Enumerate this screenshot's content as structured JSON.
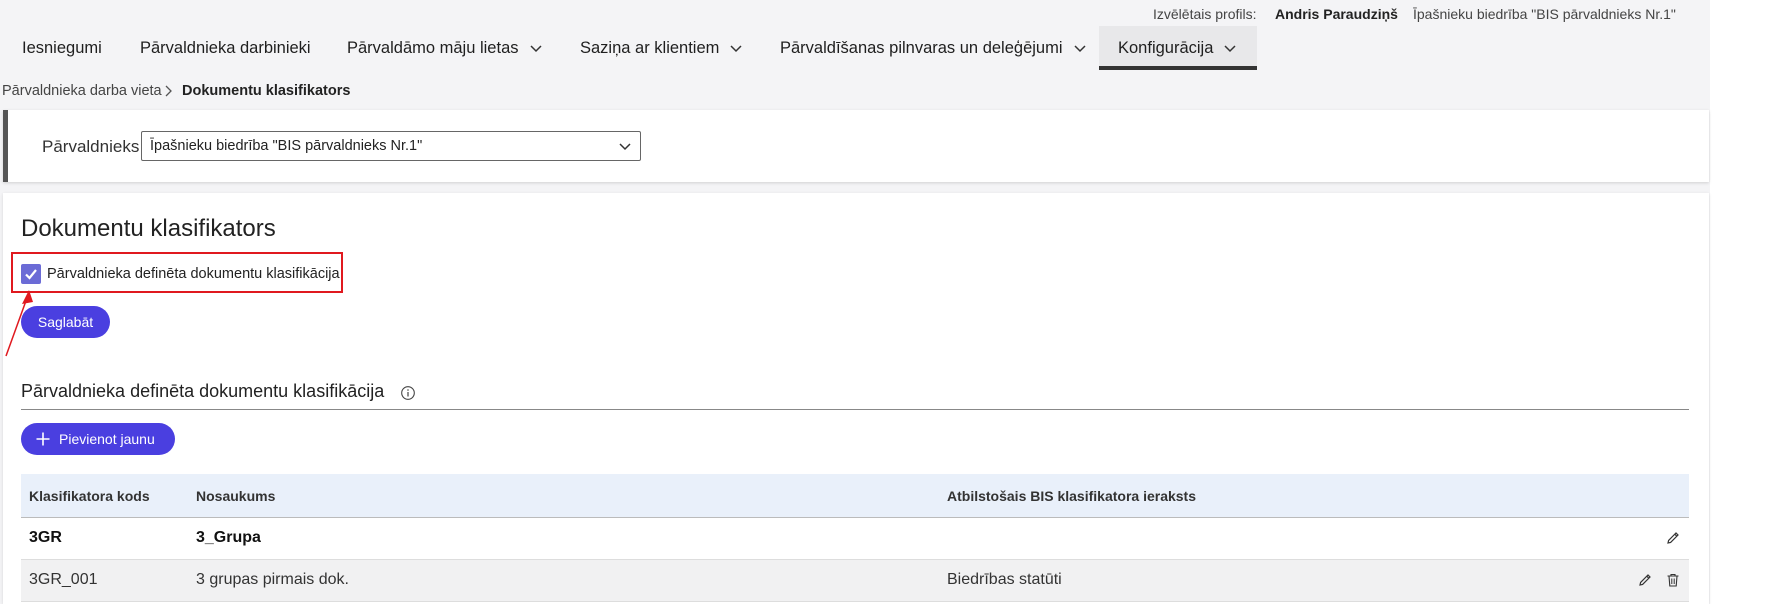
{
  "profile": {
    "label": "Izvēlētais profils:",
    "user": "Andris Paraudziņš",
    "organization": "Īpašnieku biedrība \"BIS pārvaldnieks Nr.1\""
  },
  "nav": [
    {
      "label": "Iesniegumi",
      "dropdown": false,
      "active": false
    },
    {
      "label": "Pārvaldnieka darbinieki",
      "dropdown": false,
      "active": false
    },
    {
      "label": "Pārvaldāmo māju lietas",
      "dropdown": true,
      "active": false
    },
    {
      "label": "Saziņa ar klientiem",
      "dropdown": true,
      "active": false
    },
    {
      "label": "Pārvaldīšanas pilnvaras un deleģējumi",
      "dropdown": true,
      "active": false
    },
    {
      "label": "Konfigurācija",
      "dropdown": true,
      "active": true
    }
  ],
  "breadcrumb": {
    "parent": "Pārvaldnieka darba vieta",
    "current": "Dokumentu klasifikators"
  },
  "manager": {
    "label": "Pārvaldnieks",
    "selected": "Īpašnieku biedrība \"BIS pārvaldnieks Nr.1\""
  },
  "main": {
    "title": "Dokumentu klasifikators",
    "checkbox_label": "Pārvaldnieka definēta dokumentu klasifikācija",
    "checkbox_checked": true,
    "save_label": "Saglabāt",
    "section_title": "Pārvaldnieka definēta dokumentu klasifikācija",
    "add_label": "Pievienot jaunu"
  },
  "table": {
    "columns": [
      "Klasifikatora kods",
      "Nosaukums",
      "Atbilstošais BIS klasifikatora ieraksts"
    ],
    "rows": [
      {
        "code": "3GR",
        "name": "3_Grupa",
        "bis": "",
        "group": true
      },
      {
        "code": "3GR_001",
        "name": "3 grupas pirmais dok.",
        "bis": "Biedrības statūti",
        "group": false
      }
    ]
  },
  "colors": {
    "accent": "#4a3fe0",
    "checkbox": "#6b6bd6",
    "highlight": "#e0191f",
    "table_header": "#e9f0fa"
  },
  "icons": [
    "chevron-down-icon",
    "chevron-right-icon",
    "info-icon",
    "plus-icon",
    "check-icon",
    "pencil-icon",
    "trash-icon"
  ]
}
